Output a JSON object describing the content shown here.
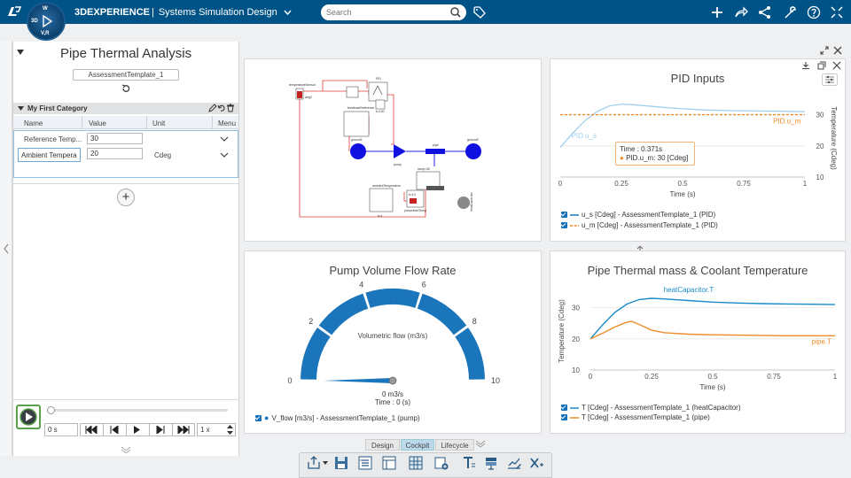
{
  "app": {
    "brand_bold": "3DEXPERIENCE",
    "separator": "|",
    "app_name": "Systems Simulation Design",
    "compass_label": "V,R",
    "compass_left": "3D",
    "compass_top": "W"
  },
  "search": {
    "placeholder": "Search"
  },
  "left_panel": {
    "title": "Pipe Thermal Analysis",
    "template": "AssessmentTemplate_1",
    "category": "My First Category",
    "columns": [
      "Name",
      "Value",
      "Unit",
      "Menu"
    ],
    "rows": [
      {
        "name": "Reference Temp...",
        "value": "30",
        "unit": ""
      },
      {
        "name": "Ambient Tempera",
        "value": "20",
        "unit": "Cdeg"
      }
    ],
    "add_symbol": "+",
    "time_value": "0 s",
    "speed_value": "1 x"
  },
  "diagram": {
    "labels": {
      "sensor": "temperatureSensor",
      "pid": "PID",
      "degc": "degC",
      "feedback": "feedbackReference",
      "kd": "k=100",
      "ground1": "ground1",
      "pump": "pump",
      "pipe": "pipe",
      "ground2": "ground2",
      "ambient": "ambientTemperature",
      "k1": "k=1",
      "prescribed": "prescribedTemp",
      "ramp": "ramp=30",
      "ti": "k=10",
      "hc": "heatCapacitor"
    }
  },
  "pid_chart": {
    "title": "PID Inputs",
    "ylabel": "Temperature (Cdeg)",
    "xlabel": "Time (s)",
    "tooltip_time": "Time : 0.371s",
    "tooltip_value": "PID.u_m: 30 [Cdeg]",
    "series_label_um": "PID.u_m",
    "series_label_us": "PID.u_s",
    "legend": [
      "u_s [Cdeg] - AssessmentTemplate_1 (PID)",
      "u_m [Cdeg] - AssessmentTemplate_1 (PID)"
    ]
  },
  "pump_chart": {
    "title": "Pump Volume Flow Rate",
    "gauge_label": "Volumetric flow (m3/s)",
    "readout": "0 m3/s",
    "time_readout": "Time : 0 (s)",
    "legend": "V_flow [m3/s] - AssessmentTemplate_1 (pump)"
  },
  "thermal_chart": {
    "title": "Pipe Thermal mass & Coolant Temperature",
    "ylabel": "Temperature (Cdeg)",
    "xlabel": "Time (s)",
    "label_hc": "heatCapacitor.T",
    "label_pipe": "pipe.T",
    "legend": [
      "T [Cdeg] - AssessmentTemplate_1 (heatCapacitor)",
      "T [Cdeg] - AssessmentTemplate_1 (pipe)"
    ]
  },
  "tabs": [
    "Design",
    "Cockpit",
    "Lifecycle"
  ],
  "colors": {
    "header": "#005386",
    "accent": "#0a7bc2",
    "orange": "#ee8c2b",
    "light_blue": "#9fd0ef",
    "gauge": "#1a75bb"
  },
  "chart_data": [
    {
      "type": "line",
      "title": "PID Inputs",
      "xlabel": "Time (s)",
      "ylabel": "Temperature (Cdeg)",
      "xlim": [
        0,
        1
      ],
      "ylim": [
        10,
        35
      ],
      "x_ticks": [
        0,
        0.25,
        0.5,
        0.75,
        1
      ],
      "y_ticks": [
        10,
        20,
        30
      ],
      "series": [
        {
          "name": "PID.u_s",
          "x": [
            0,
            0.05,
            0.1,
            0.15,
            0.2,
            0.25,
            0.3,
            0.4,
            0.5,
            0.6,
            0.7,
            0.8,
            0.9,
            1.0
          ],
          "y": [
            19.5,
            24,
            28,
            31,
            32.8,
            33.4,
            33.2,
            32.5,
            31.9,
            31.5,
            31.3,
            31.2,
            31.1,
            31.0
          ]
        },
        {
          "name": "PID.u_m",
          "x": [
            0,
            1
          ],
          "y": [
            30,
            30
          ]
        }
      ]
    },
    {
      "type": "gauge",
      "title": "Pump Volume Flow Rate",
      "label": "Volumetric flow (m3/s)",
      "ticks": [
        0,
        2,
        4,
        6,
        8,
        10
      ],
      "value": 0,
      "range": [
        0,
        10
      ]
    },
    {
      "type": "line",
      "title": "Pipe Thermal mass & Coolant Temperature",
      "xlabel": "Time (s)",
      "ylabel": "Temperature (Cdeg)",
      "xlim": [
        0,
        1
      ],
      "ylim": [
        10,
        35
      ],
      "x_ticks": [
        0,
        0.25,
        0.5,
        0.75,
        1
      ],
      "y_ticks": [
        10,
        20,
        30
      ],
      "series": [
        {
          "name": "heatCapacitor.T",
          "x": [
            0,
            0.05,
            0.1,
            0.15,
            0.2,
            0.25,
            0.3,
            0.4,
            0.5,
            0.6,
            0.7,
            0.8,
            0.9,
            1.0
          ],
          "y": [
            20,
            24.5,
            28.5,
            31.2,
            32.6,
            33.0,
            32.8,
            32.3,
            31.8,
            31.5,
            31.3,
            31.2,
            31.1,
            31.0
          ]
        },
        {
          "name": "pipe.T",
          "x": [
            0,
            0.05,
            0.1,
            0.15,
            0.17,
            0.2,
            0.25,
            0.3,
            0.4,
            0.5,
            0.6,
            0.7,
            0.8,
            0.9,
            1.0
          ],
          "y": [
            20,
            21.8,
            23.8,
            25.4,
            25.6,
            24.6,
            22.8,
            22.0,
            21.5,
            21.3,
            21.2,
            21.1,
            21.0,
            21.0,
            21.0
          ]
        }
      ]
    }
  ]
}
